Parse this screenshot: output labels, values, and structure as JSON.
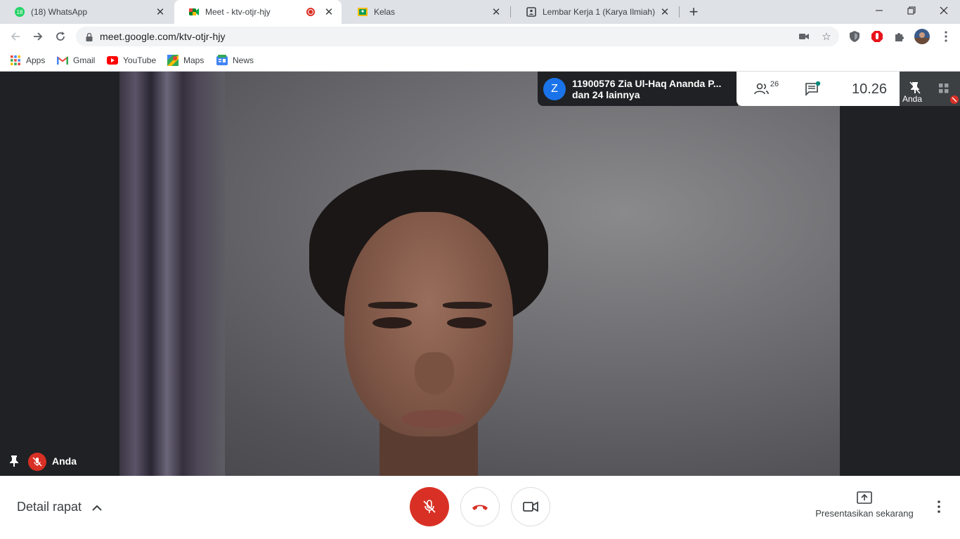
{
  "browser": {
    "tabs": [
      {
        "title": "(18) WhatsApp",
        "badge": "18",
        "favicon": "whatsapp-icon"
      },
      {
        "title": "Meet - ktv-otjr-hjy",
        "favicon": "google-meet-icon",
        "recording": true
      },
      {
        "title": "Kelas",
        "favicon": "google-classroom-icon"
      },
      {
        "title": "Lembar Kerja 1 (Karya Ilmiah)",
        "favicon": "classroom-assignment-icon"
      }
    ],
    "url": "meet.google.com/ktv-otjr-hjy"
  },
  "bookmarks": [
    {
      "label": "Apps",
      "icon": "apps-grid-icon"
    },
    {
      "label": "Gmail",
      "icon": "gmail-icon"
    },
    {
      "label": "YouTube",
      "icon": "youtube-icon"
    },
    {
      "label": "Maps",
      "icon": "maps-icon"
    },
    {
      "label": "News",
      "icon": "google-news-icon"
    }
  ],
  "meet": {
    "speaker": {
      "avatar_letter": "Z",
      "line1": "11900576 Zia Ul-Haq Ananda P...",
      "line2": "dan 24 lainnya"
    },
    "participants_count": "26",
    "time": "10.26",
    "self_label": "Anda",
    "local_tile_name": "Anda",
    "meeting_details": "Detail rapat",
    "present_now": "Presentasikan sekarang"
  },
  "colors": {
    "accent_red": "#d93025",
    "meet_blue": "#1a73e8",
    "chat_dot": "#00897b"
  }
}
